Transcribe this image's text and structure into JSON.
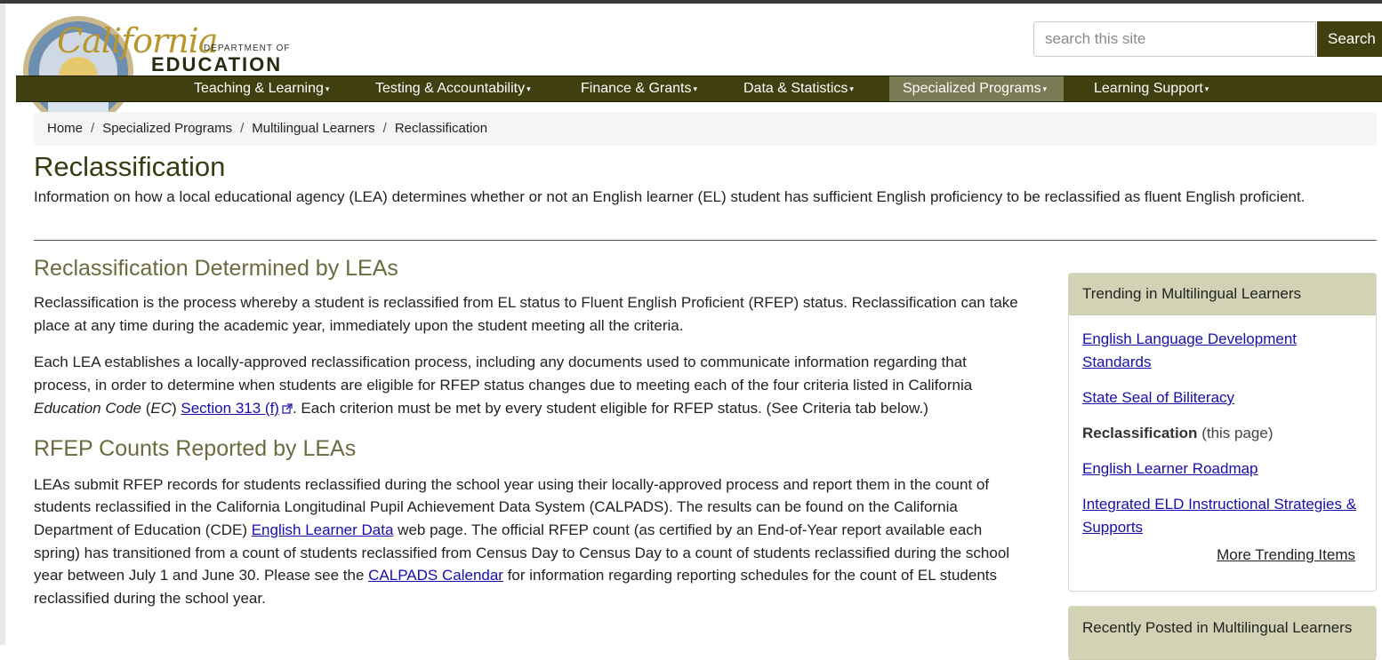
{
  "header": {
    "logo_script": "California",
    "logo_dept": "DEPARTMENT OF",
    "logo_edu": "EDUCATION",
    "search_placeholder": "search this site",
    "search_button": "Search"
  },
  "nav": {
    "items": [
      {
        "label": "Teaching & Learning",
        "active": false
      },
      {
        "label": "Testing & Accountability",
        "active": false
      },
      {
        "label": "Finance & Grants",
        "active": false
      },
      {
        "label": "Data & Statistics",
        "active": false
      },
      {
        "label": "Specialized Programs",
        "active": true
      },
      {
        "label": "Learning Support",
        "active": false
      }
    ]
  },
  "breadcrumb": [
    "Home",
    "Specialized Programs",
    "Multilingual Learners",
    "Reclassification"
  ],
  "page": {
    "title": "Reclassification",
    "intro": "Information on how a local educational agency (LEA) determines whether or not an English learner (EL) student has sufficient English proficiency to be reclassified as fluent English proficient."
  },
  "sections": {
    "s1_heading": "Reclassification Determined by LEAs",
    "s1_p1": "Reclassification is the process whereby a student is reclassified from EL status to Fluent English Proficient (RFEP) status. Reclassification can take place at any time during the academic year, immediately upon the student meeting all the criteria.",
    "s1_p2_a": "Each LEA establishes a locally-approved reclassification process, including any documents used to communicate information regarding that process, in order to determine when students are eligible for RFEP status changes due to meeting each of the four criteria listed in California ",
    "s1_p2_ec_italic": "Education Code",
    "s1_p2_ec_abbr_open": " (",
    "s1_p2_ec_abbr": "EC",
    "s1_p2_ec_abbr_close": ") ",
    "s1_p2_link": "Section 313 (f)",
    "s1_p2_b": ". Each criterion must be met by every student eligible for RFEP status. (See Criteria tab below.)",
    "s2_heading": "RFEP Counts Reported by LEAs",
    "s2_p1_a": "LEAs submit RFEP records for students reclassified during the school year using their locally-approved process and report them in the count of students reclassified in the California Longitudinal Pupil Achievement Data System (CALPADS). The results can be found on the California Department of Education (CDE) ",
    "s2_p1_link1": "English Learner Data",
    "s2_p1_b": " web page. The official RFEP count (as certified by an End-of-Year report available each spring) has transitioned from a count of students reclassified from Census Day to Census Day to a count of students reclassified during the school year between July 1 and June 30. Please see the ",
    "s2_p1_link2": "CALPADS Calendar",
    "s2_p1_c": " for information regarding reporting schedules for the count of EL students reclassified during the school year."
  },
  "sidebar": {
    "trending_heading": "Trending in Multilingual Learners",
    "trending_items": [
      {
        "label": "English Language Development Standards",
        "link": true
      },
      {
        "label": "State Seal of Biliteracy",
        "link": true
      },
      {
        "label": "Reclassification",
        "note": "(this page)",
        "link": false
      },
      {
        "label": "English Learner Roadmap",
        "link": true
      },
      {
        "label": "Integrated ELD Instructional Strategies & Supports",
        "link": true
      }
    ],
    "more_trending": "More Trending Items",
    "recent_heading": "Recently Posted in Multilingual Learners"
  }
}
